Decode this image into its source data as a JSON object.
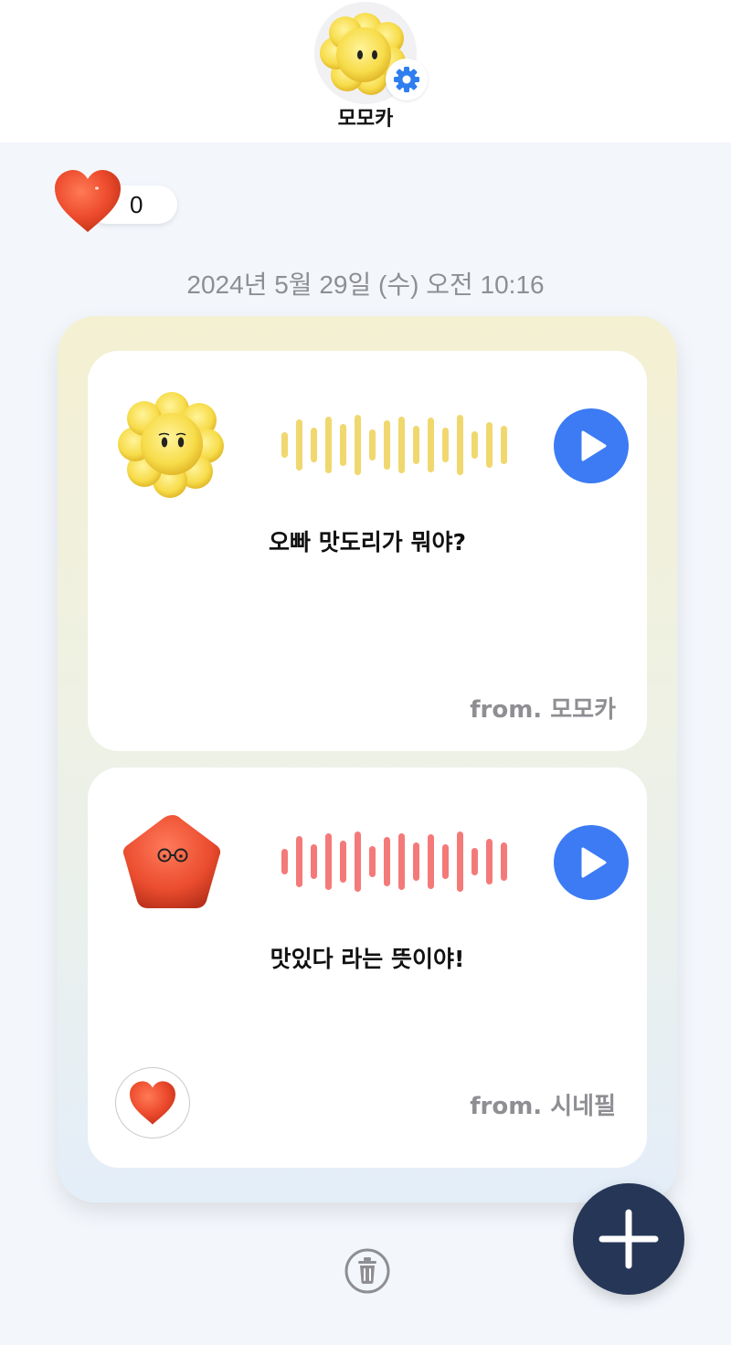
{
  "profile": {
    "name": "모모카",
    "avatar_icon": "yellow-flower-character-icon",
    "settings_icon": "gear-icon"
  },
  "likes": {
    "count": "0",
    "icon": "heart-icon"
  },
  "date": "2024년 5월 29일 (수) 오전 10:16",
  "messages": [
    {
      "text": "오빠 맛도리가 뭐야?",
      "from": "from. 모모카",
      "avatar_icon": "yellow-flower-character-icon",
      "wave_color": "#f0d86e"
    },
    {
      "text": "맛있다 라는 뜻이야!",
      "from": "from. 시네필",
      "avatar_icon": "red-star-glasses-character-icon",
      "wave_color": "#f47a7a"
    }
  ],
  "colors": {
    "accent_blue": "#3c7bf4",
    "fab_navy": "#263657",
    "heart_red": "#e8442b"
  }
}
